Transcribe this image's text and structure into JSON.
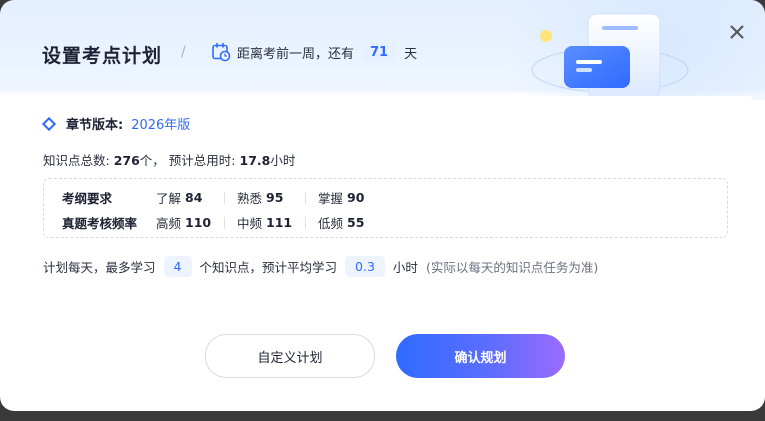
{
  "header": {
    "title": "设置考点计划",
    "countdown_prefix": "距离考前一周，还有",
    "countdown_days": "71",
    "countdown_suffix": "天"
  },
  "edition": {
    "label": "章节版本:",
    "value": "2026年版"
  },
  "totals": {
    "kp_label": "知识点总数:",
    "kp_count": "276",
    "kp_unit": "个，",
    "time_label": "预计总用时:",
    "time_value": "17.8",
    "time_unit": "小时"
  },
  "stats": {
    "rows": [
      {
        "header": "考纲要求",
        "items": [
          {
            "label": "了解",
            "value": "84"
          },
          {
            "label": "熟悉",
            "value": "95"
          },
          {
            "label": "掌握",
            "value": "90"
          }
        ]
      },
      {
        "header": "真题考核频率",
        "items": [
          {
            "label": "高频",
            "value": "110"
          },
          {
            "label": "中频",
            "value": "111"
          },
          {
            "label": "低频",
            "value": "55"
          }
        ]
      }
    ]
  },
  "plan": {
    "prefix": "计划每天，最多学习",
    "kp_per_day": "4",
    "middle": "个知识点，预计平均学习",
    "hours_per_day": "0.3",
    "suffix": "小时",
    "note": "(实际以每天的知识点任务为准)"
  },
  "buttons": {
    "custom_label": "自定义计划",
    "confirm_label": "确认规划"
  },
  "colors": {
    "accent": "#2f6bff",
    "gradient_end": "#9a6bff"
  },
  "icons": {
    "calendar": "calendar-clock-icon",
    "close": "close-icon",
    "diamond": "diamond-bullet-icon"
  }
}
